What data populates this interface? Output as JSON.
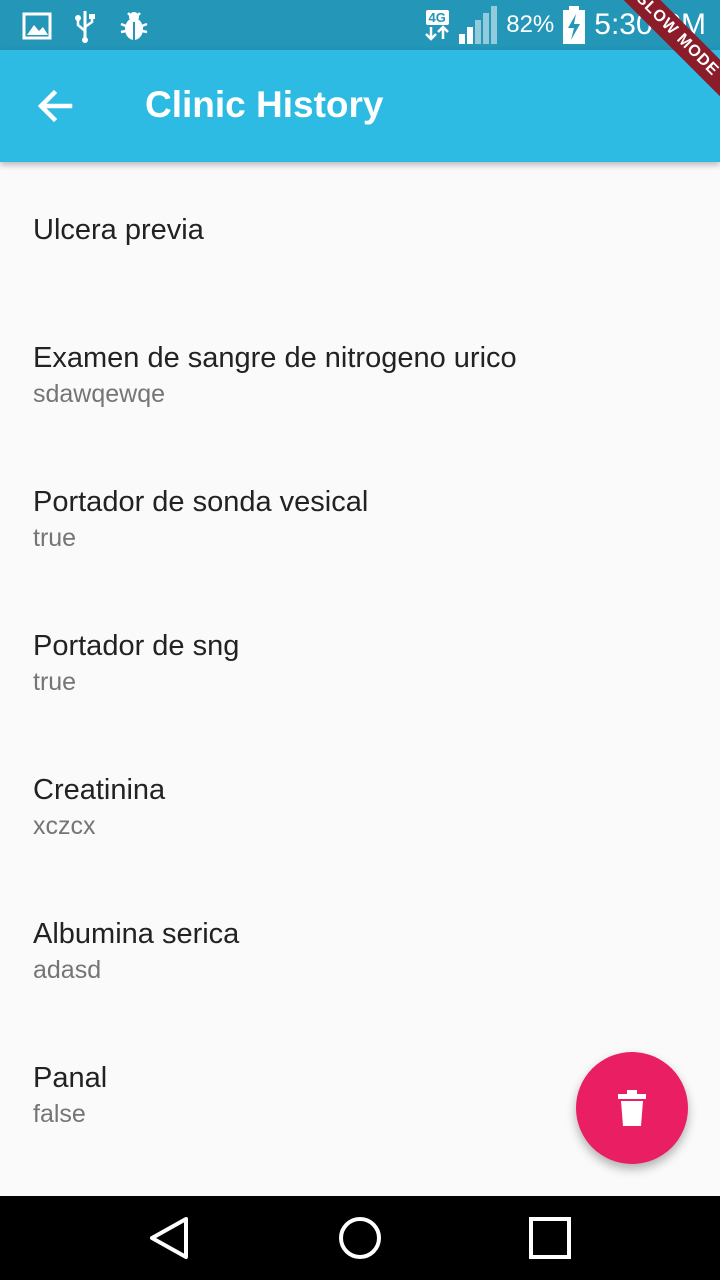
{
  "status_bar": {
    "network": "4G",
    "battery": "82%",
    "time": "5:30 PM",
    "ribbon": "SLOW MODE",
    "icons": [
      "image-icon",
      "usb-icon",
      "bug-icon"
    ]
  },
  "app_bar": {
    "title": "Clinic History",
    "back_icon": "arrow-back-icon"
  },
  "list": [
    {
      "title": "Ulcera previa",
      "subtitle": ""
    },
    {
      "title": "Examen de sangre de nitrogeno urico",
      "subtitle": "sdawqewqe"
    },
    {
      "title": "Portador de sonda vesical",
      "subtitle": "true"
    },
    {
      "title": "Portador de sng",
      "subtitle": "true"
    },
    {
      "title": "Creatinina",
      "subtitle": "xczcx"
    },
    {
      "title": "Albumina serica",
      "subtitle": "adasd"
    },
    {
      "title": "Panal",
      "subtitle": "false"
    }
  ],
  "fab": {
    "icon": "trash-icon"
  },
  "nav_bar": {
    "icons": [
      "back-triangle-icon",
      "home-circle-icon",
      "recents-square-icon"
    ]
  },
  "colors": {
    "app_bar": "#2dbbe3",
    "status_bar": "#2496b8",
    "fab": "#e91e63",
    "background": "#fafafa"
  }
}
